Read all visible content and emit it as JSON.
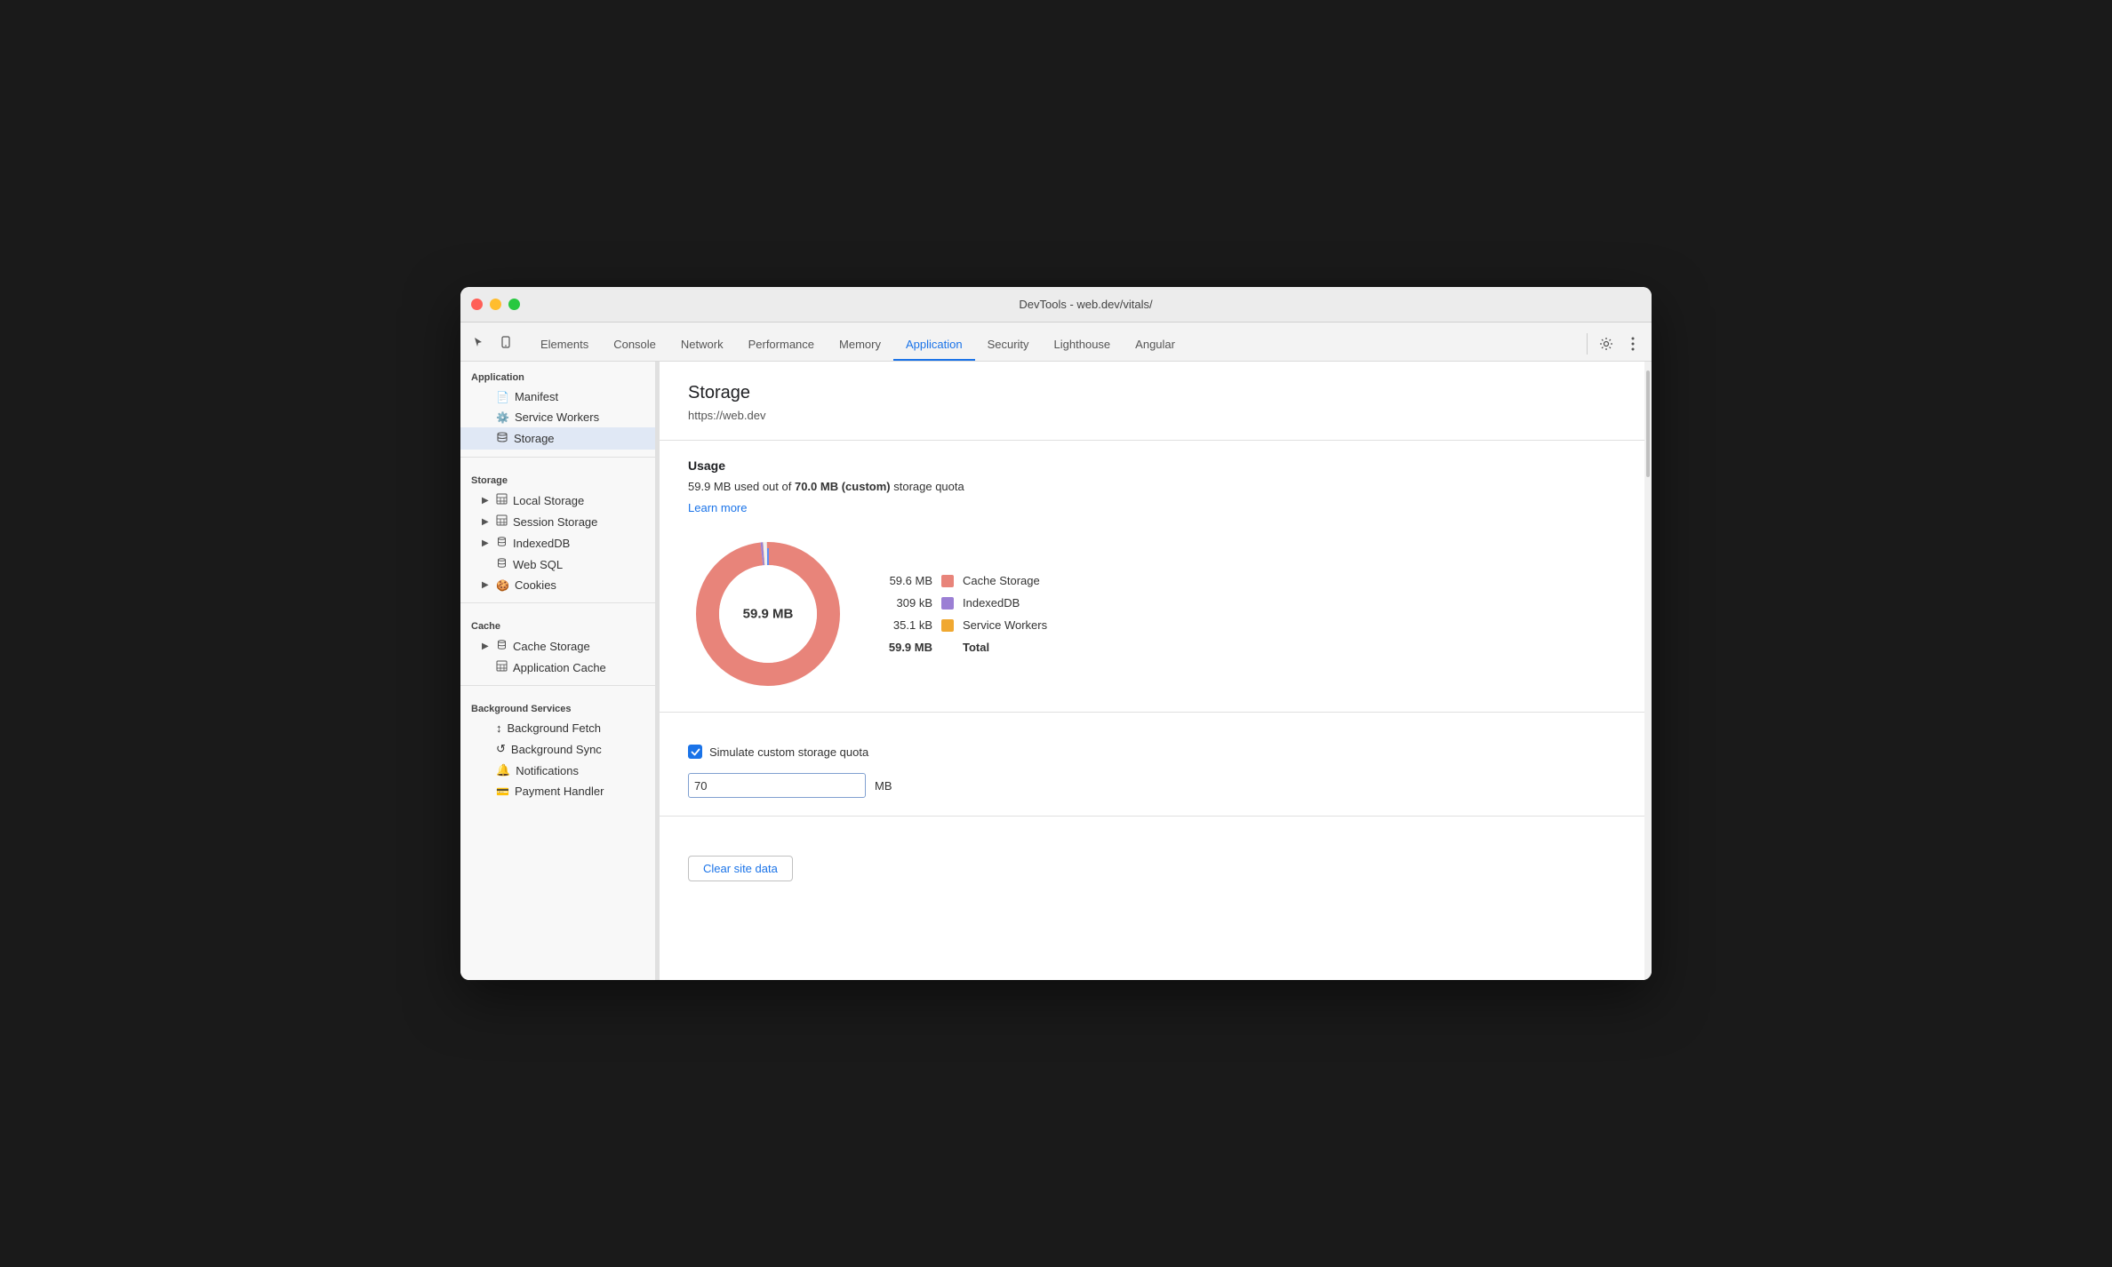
{
  "window": {
    "title": "DevTools - web.dev/vitals/"
  },
  "tabs": {
    "items": [
      {
        "label": "Elements",
        "active": false
      },
      {
        "label": "Console",
        "active": false
      },
      {
        "label": "Network",
        "active": false
      },
      {
        "label": "Performance",
        "active": false
      },
      {
        "label": "Memory",
        "active": false
      },
      {
        "label": "Application",
        "active": true
      },
      {
        "label": "Security",
        "active": false
      },
      {
        "label": "Lighthouse",
        "active": false
      },
      {
        "label": "Angular",
        "active": false
      }
    ]
  },
  "sidebar": {
    "sections": [
      {
        "header": "Application",
        "items": [
          {
            "label": "Manifest",
            "icon": "📄",
            "indent": 1,
            "expand": false,
            "active": false
          },
          {
            "label": "Service Workers",
            "icon": "⚙️",
            "indent": 1,
            "expand": false,
            "active": false
          },
          {
            "label": "Storage",
            "icon": "🗄️",
            "indent": 1,
            "expand": false,
            "active": true
          }
        ]
      },
      {
        "header": "Storage",
        "items": [
          {
            "label": "Local Storage",
            "icon": "▦",
            "indent": 1,
            "expand": true,
            "active": false
          },
          {
            "label": "Session Storage",
            "icon": "▦",
            "indent": 1,
            "expand": true,
            "active": false
          },
          {
            "label": "IndexedDB",
            "icon": "🗄️",
            "indent": 1,
            "expand": true,
            "active": false
          },
          {
            "label": "Web SQL",
            "icon": "🗄️",
            "indent": 1,
            "expand": false,
            "active": false
          },
          {
            "label": "Cookies",
            "icon": "🍪",
            "indent": 1,
            "expand": true,
            "active": false
          }
        ]
      },
      {
        "header": "Cache",
        "items": [
          {
            "label": "Cache Storage",
            "icon": "🗄️",
            "indent": 1,
            "expand": true,
            "active": false
          },
          {
            "label": "Application Cache",
            "icon": "▦",
            "indent": 1,
            "expand": false,
            "active": false
          }
        ]
      },
      {
        "header": "Background Services",
        "items": [
          {
            "label": "Background Fetch",
            "icon": "↕",
            "indent": 1,
            "expand": false,
            "active": false
          },
          {
            "label": "Background Sync",
            "icon": "↺",
            "indent": 1,
            "expand": false,
            "active": false
          },
          {
            "label": "Notifications",
            "icon": "🔔",
            "indent": 1,
            "expand": false,
            "active": false
          },
          {
            "label": "Payment Handler",
            "icon": "💳",
            "indent": 1,
            "expand": false,
            "active": false
          }
        ]
      }
    ]
  },
  "main": {
    "page_title": "Storage",
    "url": "https://web.dev",
    "usage": {
      "section_title": "Usage",
      "description_pre": "59.9 MB used out of ",
      "description_bold": "70.0 MB (custom)",
      "description_post": " storage quota",
      "learn_more": "Learn more",
      "total_label": "59.9 MB",
      "donut_label": "59.9 MB",
      "legend": [
        {
          "size": "59.6 MB",
          "color": "#e8847a",
          "name": "Cache Storage"
        },
        {
          "size": "309 kB",
          "color": "#9b7fd4",
          "name": "IndexedDB"
        },
        {
          "size": "35.1 kB",
          "color": "#f0a830",
          "name": "Service Workers"
        },
        {
          "size": "59.9 MB",
          "color": "",
          "name": "Total",
          "is_total": true
        }
      ]
    },
    "simulate": {
      "label": "Simulate custom storage quota",
      "checked": true
    },
    "quota": {
      "value": "70",
      "unit": "MB"
    },
    "clear_button": "Clear site data"
  }
}
